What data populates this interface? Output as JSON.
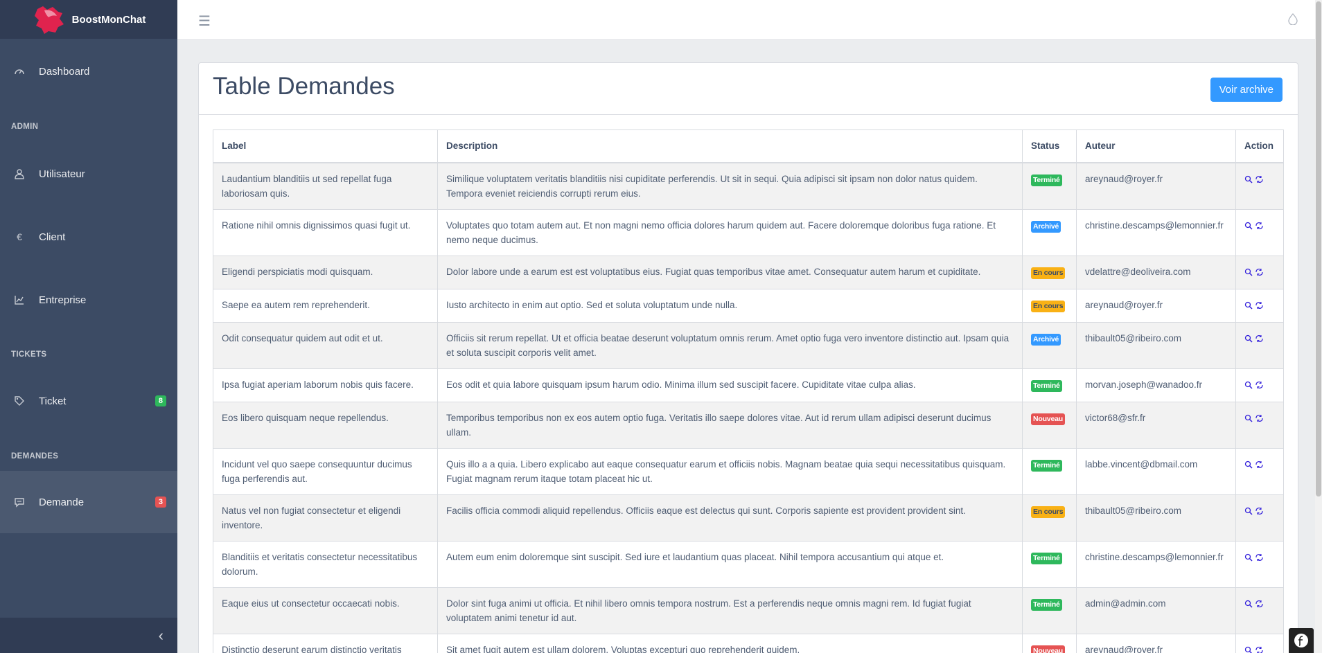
{
  "app": {
    "name": "BoostMonChat"
  },
  "sidebar": {
    "dashboard": "Dashboard",
    "section_admin": "ADMIN",
    "utilisateur": "Utilisateur",
    "client": "Client",
    "entreprise": "Entreprise",
    "section_tickets": "TICKETS",
    "ticket": "Ticket",
    "ticket_badge": "8",
    "section_demandes": "DEMANDES",
    "demande": "Demande",
    "demande_badge": "3",
    "colors": {
      "bg": "#3c4b64",
      "success": "#2eb85c",
      "danger": "#e55353"
    }
  },
  "page": {
    "title": "Table Demandes",
    "archive_button": "Voir archive"
  },
  "table": {
    "headers": {
      "label": "Label",
      "description": "Description",
      "status": "Status",
      "auteur": "Auteur",
      "action": "Action"
    },
    "rows": [
      {
        "label": "Laudantium blanditiis ut sed repellat fuga laboriosam quis.",
        "description": "Similique voluptatem veritatis blanditiis nisi cupiditate perferendis. Ut sit in sequi. Quia adipisci sit ipsam non dolor natus quidem. Tempora eveniet reiciendis corrupti rerum eius.",
        "status": "Terminé",
        "auteur": "areynaud@royer.fr"
      },
      {
        "label": "Ratione nihil omnis dignissimos quasi fugit ut.",
        "description": "Voluptates quo totam autem aut. Et non magni nemo officia dolores harum quidem aut. Facere doloremque doloribus fuga ratione. Et nemo neque ducimus.",
        "status": "Archivé",
        "auteur": "christine.descamps@lemonnier.fr"
      },
      {
        "label": "Eligendi perspiciatis modi quisquam.",
        "description": "Dolor labore unde a earum est est voluptatibus eius. Fugiat quas temporibus vitae amet. Consequatur autem harum et cupiditate.",
        "status": "En cours",
        "auteur": "vdelattre@deoliveira.com"
      },
      {
        "label": "Saepe ea autem rem reprehenderit.",
        "description": "Iusto architecto in enim aut optio. Sed et soluta voluptatum unde nulla.",
        "status": "En cours",
        "auteur": "areynaud@royer.fr"
      },
      {
        "label": "Odit consequatur quidem aut odit et ut.",
        "description": "Officiis sit rerum repellat. Ut et officia beatae deserunt voluptatum omnis rerum. Amet optio fuga vero inventore distinctio aut. Ipsam quia et soluta suscipit corporis velit amet.",
        "status": "Archivé",
        "auteur": "thibault05@ribeiro.com"
      },
      {
        "label": "Ipsa fugiat aperiam laborum nobis quis facere.",
        "description": "Eos odit et quia labore quisquam ipsum harum odio. Minima illum sed suscipit facere. Cupiditate vitae culpa alias.",
        "status": "Terminé",
        "auteur": "morvan.joseph@wanadoo.fr"
      },
      {
        "label": "Eos libero quisquam neque repellendus.",
        "description": "Temporibus temporibus non ex eos autem optio fuga. Veritatis illo saepe dolores vitae. Aut id rerum ullam adipisci deserunt ducimus ullam.",
        "status": "Nouveau",
        "auteur": "victor68@sfr.fr"
      },
      {
        "label": "Incidunt vel quo saepe consequuntur ducimus fuga perferendis aut.",
        "description": "Quis illo a a quia. Libero explicabo aut eaque consequatur earum et officiis nobis. Magnam beatae quia sequi necessitatibus quisquam. Fugiat magnam rerum itaque totam placeat hic ut.",
        "status": "Terminé",
        "auteur": "labbe.vincent@dbmail.com"
      },
      {
        "label": "Natus vel non fugiat consectetur et eligendi inventore.",
        "description": "Facilis officia commodi aliquid repellendus. Officiis eaque est delectus qui sunt. Corporis sapiente est provident provident sint.",
        "status": "En cours",
        "auteur": "thibault05@ribeiro.com"
      },
      {
        "label": "Blanditiis et veritatis consectetur necessitatibus dolorum.",
        "description": "Autem eum enim doloremque sint suscipit. Sed iure et laudantium quas placeat. Nihil tempora accusantium qui atque et.",
        "status": "Terminé",
        "auteur": "christine.descamps@lemonnier.fr"
      },
      {
        "label": "Eaque eius ut consectetur occaecati nobis.",
        "description": "Dolor sint fuga animi ut officia. Et nihil libero omnis tempora nostrum. Est a perferendis neque omnis magni rem. Id fugiat fugiat voluptatem animi tenetur id aut.",
        "status": "Terminé",
        "auteur": "admin@admin.com"
      },
      {
        "label": "Distinctio deserunt earum distinctio veritatis",
        "description": "Sit amet fugit autem est ullam dolorem. Voluptas excepturi quo reprehenderit quidem.",
        "status": "Nouveau",
        "auteur": "areynaud@royer.fr"
      }
    ]
  },
  "status_colors": {
    "Terminé": "#2eb85c",
    "Archivé": "#3399ff",
    "En cours": "#f9b115",
    "Nouveau": "#e55353"
  }
}
